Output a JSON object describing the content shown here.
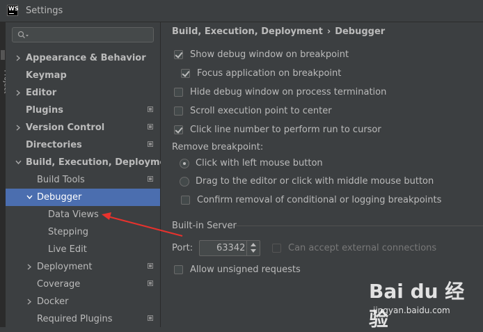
{
  "window": {
    "title": "Settings",
    "logo_text": "WS"
  },
  "left_strip": {
    "label": "Project"
  },
  "search": {
    "placeholder": ""
  },
  "tree": [
    {
      "label": "Appearance & Behavior",
      "bold": true,
      "arrow": "right",
      "indent": 0
    },
    {
      "label": "Keymap",
      "bold": true,
      "arrow": "",
      "indent": 0
    },
    {
      "label": "Editor",
      "bold": true,
      "arrow": "right",
      "indent": 0
    },
    {
      "label": "Plugins",
      "bold": true,
      "arrow": "",
      "indent": 0,
      "project_icon": true
    },
    {
      "label": "Version Control",
      "bold": true,
      "arrow": "right",
      "indent": 0,
      "project_icon": true
    },
    {
      "label": "Directories",
      "bold": true,
      "arrow": "",
      "indent": 0,
      "project_icon": true
    },
    {
      "label": "Build, Execution, Deployment",
      "bold": true,
      "arrow": "down",
      "indent": 0
    },
    {
      "label": "Build Tools",
      "bold": false,
      "arrow": "",
      "indent": 1,
      "project_icon": true
    },
    {
      "label": "Debugger",
      "bold": false,
      "arrow": "down",
      "indent": 1,
      "selected": true
    },
    {
      "label": "Data Views",
      "bold": false,
      "arrow": "",
      "indent": 2
    },
    {
      "label": "Stepping",
      "bold": false,
      "arrow": "",
      "indent": 2
    },
    {
      "label": "Live Edit",
      "bold": false,
      "arrow": "",
      "indent": 2
    },
    {
      "label": "Deployment",
      "bold": false,
      "arrow": "right",
      "indent": 1,
      "project_icon": true
    },
    {
      "label": "Coverage",
      "bold": false,
      "arrow": "",
      "indent": 1,
      "project_icon": true
    },
    {
      "label": "Docker",
      "bold": false,
      "arrow": "right",
      "indent": 1
    },
    {
      "label": "Required Plugins",
      "bold": false,
      "arrow": "",
      "indent": 1,
      "project_icon": true
    }
  ],
  "breadcrumb": {
    "parent": "Build, Execution, Deployment",
    "separator": "›",
    "current": "Debugger"
  },
  "options": {
    "show_debug_window": "Show debug window on breakpoint",
    "focus_application": "Focus application on breakpoint",
    "hide_debug_window": "Hide debug window on process termination",
    "scroll_execution_point": "Scroll execution point to center",
    "click_line_number": "Click line number to perform run to cursor"
  },
  "remove_breakpoint": {
    "label": "Remove breakpoint:",
    "click_left": "Click with left mouse button",
    "drag_to_editor": "Drag to the editor or click with middle mouse button",
    "confirm_removal": "Confirm removal of conditional or logging breakpoints"
  },
  "builtin_server": {
    "label": "Built-in Server",
    "port_label": "Port:",
    "port_value": "63342",
    "external_connections": "Can accept external connections",
    "allow_unsigned": "Allow unsigned requests"
  },
  "watermark": {
    "brand": "Bai du 经验",
    "url": "jingyan.baidu.com"
  },
  "colors": {
    "selection": "#4b6eaf",
    "annotation_arrow": "#e8322d",
    "background": "#3c3f41"
  }
}
